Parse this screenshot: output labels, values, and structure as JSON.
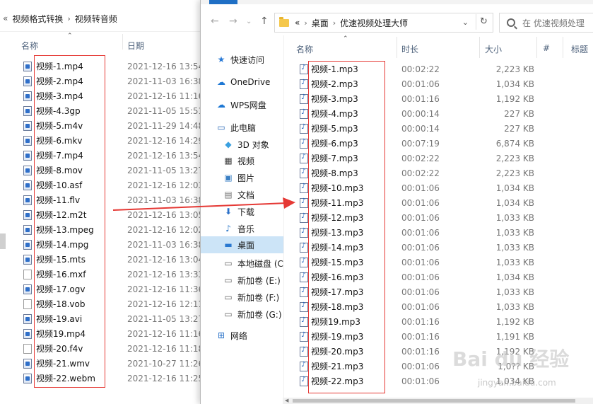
{
  "left_window": {
    "breadcrumb": [
      "视频格式转换",
      "视频转音频"
    ],
    "columns": {
      "name": "名称",
      "date": "日期"
    },
    "files": [
      {
        "name": "视频-1.mp4",
        "date": "2021-12-16 13:54",
        "icon": "video-file-icon"
      },
      {
        "name": "视频-2.mp4",
        "date": "2021-11-03 16:38",
        "icon": "video-file-icon"
      },
      {
        "name": "视频-3.mp4",
        "date": "2021-12-16 11:16",
        "icon": "video-file-icon"
      },
      {
        "name": "视频-4.3gp",
        "date": "2021-11-05 15:51",
        "icon": "video-file-icon"
      },
      {
        "name": "视频-5.m4v",
        "date": "2021-11-29 14:48",
        "icon": "video-file-icon"
      },
      {
        "name": "视频-6.mkv",
        "date": "2021-12-16 14:29",
        "icon": "video-file-icon"
      },
      {
        "name": "视频-7.mp4",
        "date": "2021-12-16 13:54",
        "icon": "video-file-icon"
      },
      {
        "name": "视频-8.mov",
        "date": "2021-11-05 13:27",
        "icon": "video-file-icon"
      },
      {
        "name": "视频-10.asf",
        "date": "2021-12-16 12:03",
        "icon": "video-file-icon"
      },
      {
        "name": "视频-11.flv",
        "date": "2021-11-03 16:38",
        "icon": "video-file-icon"
      },
      {
        "name": "视频-12.m2t",
        "date": "2021-12-16 13:05",
        "icon": "video-file-icon"
      },
      {
        "name": "视频-13.mpeg",
        "date": "2021-12-16 12:02",
        "icon": "video-file-icon"
      },
      {
        "name": "视频-14.mpg",
        "date": "2021-11-03 16:38",
        "icon": "video-file-icon"
      },
      {
        "name": "视频-15.mts",
        "date": "2021-12-16 13:04",
        "icon": "video-file-icon"
      },
      {
        "name": "视频-16.mxf",
        "date": "2021-12-16 13:33",
        "icon": "blank-file-icon"
      },
      {
        "name": "视频-17.ogv",
        "date": "2021-12-16 11:36",
        "icon": "video-file-icon"
      },
      {
        "name": "视频-18.vob",
        "date": "2021-12-16 12:11",
        "icon": "blank-file-icon"
      },
      {
        "name": "视频-19.avi",
        "date": "2021-11-05 13:27",
        "icon": "video-file-icon"
      },
      {
        "name": "视频19.mp4",
        "date": "2021-12-16 11:16",
        "icon": "video-file-icon"
      },
      {
        "name": "视频-20.f4v",
        "date": "2021-12-16 11:18",
        "icon": "blank-file-icon"
      },
      {
        "name": "视频-21.wmv",
        "date": "2021-10-27 11:26",
        "icon": "video-file-icon"
      },
      {
        "name": "视频-22.webm",
        "date": "2021-12-16 11:25",
        "icon": "video-file-icon"
      }
    ]
  },
  "right_window": {
    "address": {
      "lead": "«",
      "segments": [
        "桌面",
        "优速视频处理大师"
      ]
    },
    "search_placeholder": "在 优速视频处理",
    "nav_items": [
      {
        "label": "快速访问",
        "icon": "star-icon"
      },
      {
        "label": "OneDrive",
        "icon": "cloud-icon"
      },
      {
        "label": "WPS网盘",
        "icon": "cloud-icon"
      },
      {
        "label": "此电脑",
        "icon": "computer-icon"
      },
      {
        "label": "3D 对象",
        "icon": "cube-icon"
      },
      {
        "label": "视频",
        "icon": "film-icon"
      },
      {
        "label": "图片",
        "icon": "picture-icon"
      },
      {
        "label": "文档",
        "icon": "document-icon"
      },
      {
        "label": "下载",
        "icon": "download-icon"
      },
      {
        "label": "音乐",
        "icon": "music-icon"
      },
      {
        "label": "桌面",
        "icon": "desktop-icon"
      },
      {
        "label": "本地磁盘 (C",
        "icon": "drive-icon"
      },
      {
        "label": "新加卷 (E:)",
        "icon": "drive-icon"
      },
      {
        "label": "新加卷 (F:)",
        "icon": "drive-icon"
      },
      {
        "label": "新加卷 (G:)",
        "icon": "drive-icon"
      },
      {
        "label": "网络",
        "icon": "network-icon"
      }
    ],
    "columns": {
      "name": "名称",
      "duration": "时长",
      "size": "大小",
      "number": "#",
      "title": "标题"
    },
    "files": [
      {
        "name": "视频-1.mp3",
        "duration": "00:02:22",
        "size": "2,223 KB"
      },
      {
        "name": "视频-2.mp3",
        "duration": "00:01:06",
        "size": "1,034 KB"
      },
      {
        "name": "视频-3.mp3",
        "duration": "00:01:16",
        "size": "1,192 KB"
      },
      {
        "name": "视频-4.mp3",
        "duration": "00:00:14",
        "size": "227 KB"
      },
      {
        "name": "视频-5.mp3",
        "duration": "00:00:14",
        "size": "227 KB"
      },
      {
        "name": "视频-6.mp3",
        "duration": "00:07:19",
        "size": "6,874 KB"
      },
      {
        "name": "视频-7.mp3",
        "duration": "00:02:22",
        "size": "2,223 KB"
      },
      {
        "name": "视频-8.mp3",
        "duration": "00:02:22",
        "size": "2,223 KB"
      },
      {
        "name": "视频-10.mp3",
        "duration": "00:01:06",
        "size": "1,034 KB"
      },
      {
        "name": "视频-11.mp3",
        "duration": "00:01:06",
        "size": "1,034 KB"
      },
      {
        "name": "视频-12.mp3",
        "duration": "00:01:06",
        "size": "1,033 KB"
      },
      {
        "name": "视频-13.mp3",
        "duration": "00:01:06",
        "size": "1,033 KB"
      },
      {
        "name": "视频-14.mp3",
        "duration": "00:01:06",
        "size": "1,033 KB"
      },
      {
        "name": "视频-15.mp3",
        "duration": "00:01:06",
        "size": "1,033 KB"
      },
      {
        "name": "视频-16.mp3",
        "duration": "00:01:06",
        "size": "1,034 KB"
      },
      {
        "name": "视频-17.mp3",
        "duration": "00:01:06",
        "size": "1,033 KB"
      },
      {
        "name": "视频-18.mp3",
        "duration": "00:01:06",
        "size": "1,033 KB"
      },
      {
        "name": "视频19.mp3",
        "duration": "00:01:16",
        "size": "1,192 KB"
      },
      {
        "name": "视频-19.mp3",
        "duration": "00:01:16",
        "size": "1,191 KB"
      },
      {
        "name": "视频-20.mp3",
        "duration": "00:01:16",
        "size": "1,192 KB"
      },
      {
        "name": "视频-21.mp3",
        "duration": "00:01:06",
        "size": "1,0?? KB"
      },
      {
        "name": "视频-22.mp3",
        "duration": "00:01:06",
        "size": "1,034 KB"
      }
    ]
  },
  "annotation": {
    "box_color": "#e53935",
    "arrow_color": "#e53935"
  },
  "watermark": {
    "logo": "Bai du 经验",
    "url": "jingyan.baidu.com"
  }
}
